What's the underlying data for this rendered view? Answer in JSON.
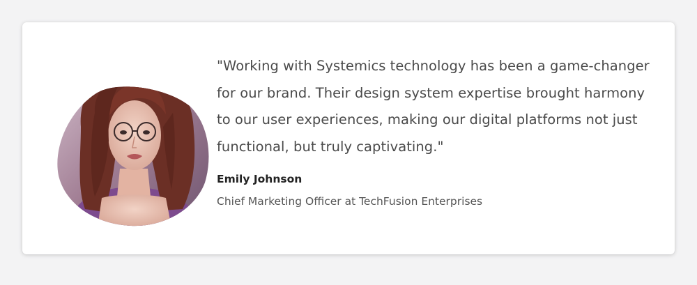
{
  "testimonial": {
    "quote": "\"Working with Systemics technology has been a game-changer for our brand. Their design system expertise brought harmony to our user experiences, making our digital platforms not just functional, but truly captivating.\"",
    "author_name": "Emily Johnson",
    "author_title": "Chief Marketing Officer at TechFusion Enterprises",
    "avatar_icon": "portrait-photo"
  },
  "colors": {
    "background": "#f3f3f4",
    "card": "#ffffff",
    "quote_text": "#4a4a4a",
    "name_text": "#222222",
    "title_text": "#555555"
  }
}
